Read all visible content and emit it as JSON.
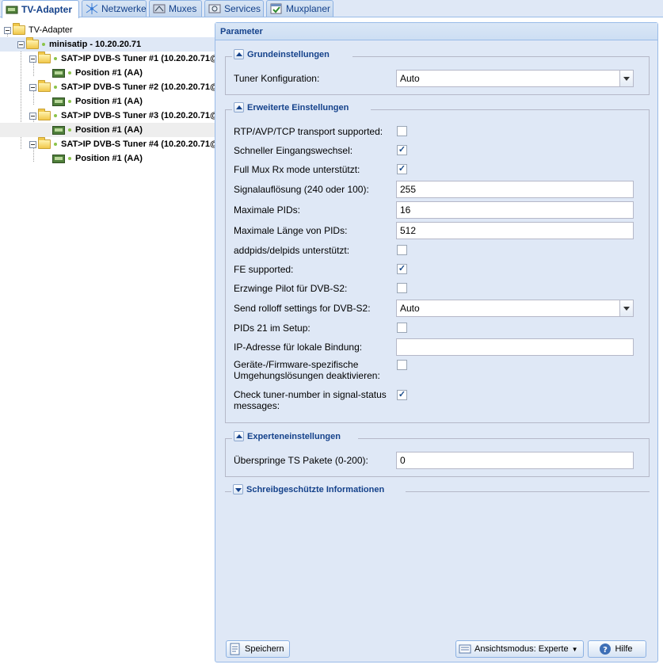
{
  "tabs": [
    {
      "label": "TV-Adapter",
      "icon": "tv-adapter-icon",
      "active": true
    },
    {
      "label": "Netzwerke",
      "icon": "network-icon",
      "active": false
    },
    {
      "label": "Muxes",
      "icon": "mux-icon",
      "active": false
    },
    {
      "label": "Services",
      "icon": "services-icon",
      "active": false
    },
    {
      "label": "Muxplaner",
      "icon": "muxplaner-icon",
      "active": false
    }
  ],
  "tree": {
    "root": "TV-Adapter",
    "adapter": "minisatip - 10.20.20.71",
    "tuners": [
      {
        "label": "SAT>IP DVB-S Tuner #1 (10.20.20.71@",
        "position": "Position #1 (AA)"
      },
      {
        "label": "SAT>IP DVB-S Tuner #2 (10.20.20.71@",
        "position": "Position #1 (AA)"
      },
      {
        "label": "SAT>IP DVB-S Tuner #3 (10.20.20.71@",
        "position": "Position #1 (AA)"
      },
      {
        "label": "SAT>IP DVB-S Tuner #4 (10.20.20.71@",
        "position": "Position #1 (AA)"
      }
    ]
  },
  "panel": {
    "title": "Parameter",
    "basic": {
      "legend": "Grundeinstellungen",
      "tuner_config_label": "Tuner Konfiguration:",
      "tuner_config_value": "Auto"
    },
    "advanced": {
      "legend": "Erweiterte Einstellungen",
      "rtp_label": "RTP/AVP/TCP transport supported:",
      "rtp_checked": false,
      "fast_switch_label": "Schneller Eingangswechsel:",
      "fast_switch_checked": true,
      "fullmux_label": "Full Mux Rx mode unterstützt:",
      "fullmux_checked": true,
      "signal_label": "Signalauflösung (240 oder 100):",
      "signal_value": "255",
      "maxpids_label": "Maximale PIDs:",
      "maxpids_value": "16",
      "maxpidlen_label": "Maximale Länge von PIDs:",
      "maxpidlen_value": "512",
      "addpids_label": "addpids/delpids unterstützt:",
      "addpids_checked": false,
      "fe_label": "FE supported:",
      "fe_checked": true,
      "pilot_label": "Erzwinge Pilot für DVB-S2:",
      "pilot_checked": false,
      "rolloff_label": "Send rolloff settings for DVB-S2:",
      "rolloff_value": "Auto",
      "pids21_label": "PIDs 21 im Setup:",
      "pids21_checked": false,
      "bind_label": "IP-Adresse für lokale Bindung:",
      "bind_value": "",
      "workaround_label": "Geräte-/Firmware-spezifische Umgehungslösungen deaktivieren:",
      "workaround_checked": false,
      "checktuner_label": "Check tuner-number in signal-status messages:",
      "checktuner_checked": true
    },
    "expert": {
      "legend": "Experteneinstellungen",
      "skip_label": "Überspringe TS Pakete (0-200):",
      "skip_value": "0"
    },
    "readonly": {
      "legend": "Schreibgeschützte Informationen"
    }
  },
  "buttons": {
    "save": "Speichern",
    "view_mode": "Ansichtsmodus: Experte",
    "help": "Hilfe"
  }
}
